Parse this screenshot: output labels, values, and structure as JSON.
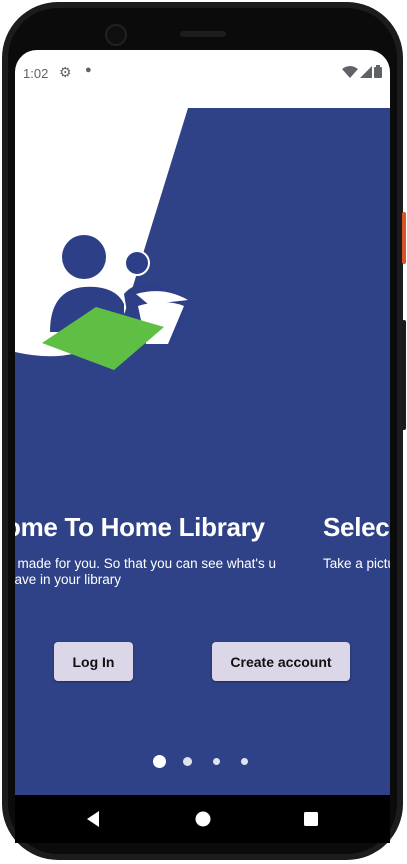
{
  "status_bar": {
    "time": "1:02",
    "icons": [
      "settings-icon",
      "notification-dot-icon",
      "wifi-icon",
      "signal-icon",
      "battery-icon"
    ]
  },
  "colors": {
    "background_blue": "#2f4287",
    "logo_blue": "#2d3f86",
    "book_green": "#5fbf45",
    "button_bg": "#dcd7e8",
    "white": "#ffffff"
  },
  "slides": [
    {
      "title": "ome To Home Library",
      "description": "s made for you. So that you can see what's u have in your library"
    },
    {
      "title": "Selec",
      "description": "Take a pictu Library"
    }
  ],
  "buttons": {
    "login": "Log In",
    "create_account": "Create account"
  },
  "pager": {
    "total_pages": 4,
    "active_page": 1
  },
  "nav_bar": {
    "icons": [
      "back-icon",
      "home-icon",
      "recents-icon"
    ]
  }
}
